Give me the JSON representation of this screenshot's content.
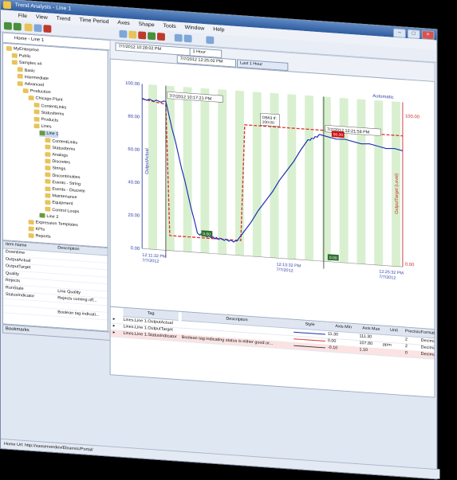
{
  "window": {
    "title": "Trend Analysis - Line 1"
  },
  "menu": [
    "File",
    "View",
    "Trend",
    "Time Period",
    "Axes",
    "Shape",
    "Tools",
    "Window",
    "Help"
  ],
  "breadcrumb": "Home - Line 1",
  "tree": [
    {
      "label": "MyEnterprise",
      "depth": 0,
      "icon": "folder"
    },
    {
      "label": "Public",
      "depth": 1,
      "icon": "folder"
    },
    {
      "label": "Samples v4",
      "depth": 1,
      "icon": "folder"
    },
    {
      "label": "Basic",
      "depth": 2,
      "icon": "folder"
    },
    {
      "label": "Intermediate",
      "depth": 2,
      "icon": "folder"
    },
    {
      "label": "Advanced",
      "depth": 2,
      "icon": "folder"
    },
    {
      "label": "Production",
      "depth": 3,
      "icon": "folder"
    },
    {
      "label": "Chicago Plant",
      "depth": 4,
      "icon": "folder"
    },
    {
      "label": "ContentLinks",
      "depth": 5,
      "icon": "folder"
    },
    {
      "label": "StatusItems",
      "depth": 5,
      "icon": "folder"
    },
    {
      "label": "Products",
      "depth": 5,
      "icon": "folder"
    },
    {
      "label": "Lines",
      "depth": 5,
      "icon": "folder"
    },
    {
      "label": "Line 1",
      "depth": 6,
      "icon": "green"
    },
    {
      "label": "ContentLinks",
      "depth": 7,
      "icon": "folder"
    },
    {
      "label": "StatusItems",
      "depth": 7,
      "icon": "folder"
    },
    {
      "label": "Analogs",
      "depth": 7,
      "icon": "folder"
    },
    {
      "label": "Discretes",
      "depth": 7,
      "icon": "folder"
    },
    {
      "label": "Strings",
      "depth": 7,
      "icon": "folder"
    },
    {
      "label": "Discontinuities",
      "depth": 7,
      "icon": "folder"
    },
    {
      "label": "Events - String",
      "depth": 7,
      "icon": "folder"
    },
    {
      "label": "Events - Discrete",
      "depth": 7,
      "icon": "folder"
    },
    {
      "label": "Maintenance",
      "depth": 7,
      "icon": "folder"
    },
    {
      "label": "Equipment",
      "depth": 7,
      "icon": "folder"
    },
    {
      "label": "Control Loops",
      "depth": 7,
      "icon": "folder"
    },
    {
      "label": "Line 2",
      "depth": 6,
      "icon": "green"
    },
    {
      "label": "Expression Templates",
      "depth": 4,
      "icon": "folder"
    },
    {
      "label": "KPIs",
      "depth": 4,
      "icon": "folder"
    },
    {
      "label": "Reports",
      "depth": 4,
      "icon": "folder"
    }
  ],
  "props": {
    "headers": [
      "Item Name",
      "Description"
    ],
    "rows": [
      {
        "name": "Downtime",
        "desc": ""
      },
      {
        "name": "OutputActual",
        "desc": ""
      },
      {
        "name": "OutputTarget",
        "desc": ""
      },
      {
        "name": "Quality",
        "desc": ""
      },
      {
        "name": "Rejects",
        "desc": ""
      },
      {
        "name": "RunState",
        "desc": "Line Quality"
      },
      {
        "name": "StatusIndicator",
        "desc": "Rejects coming off..."
      },
      {
        "name": "",
        "desc": ""
      },
      {
        "name": "",
        "desc": "Boolean tag indicati..."
      }
    ]
  },
  "bookmarks": "Bookmarks",
  "status": "Home Url:   http://vasserverdev/Ebservic/Portal/",
  "trendbar": {
    "start": "7/7/2012 10:28:02 PM",
    "end": "7/7/2012 12:25:02 PM",
    "span": "1 Hour",
    "period": "Last 1 Hour"
  },
  "chart": {
    "y_ticks": [
      "100.00",
      "80.00",
      "60.00",
      "40.00",
      "20.00",
      "0.00"
    ],
    "y_left_label": "OutputActual",
    "y_right_label": "OutputTarget (Level)",
    "right_max": "100.00",
    "right_min": "0.00",
    "corner": "Automatic",
    "x_left": "12:11:32 PM\n7/7/2012",
    "x_mid": "12:13:32 PM\n7/7/2012",
    "x_right": "12:25:32 PM\n7/7/2012",
    "cursor1": "7/7/2012 10:17:21 PM",
    "cursor2": "7/7/2012 12:21:58 PM",
    "cursor_mid": "0.00",
    "marker_a": "0.00",
    "marker_b": "90.00",
    "marker_c": "0.00",
    "note": "OB63 tf:\n100.00"
  },
  "grid": {
    "headers": [
      "Tag",
      "Description",
      "Style",
      "Axis Min",
      "Axis Max",
      "Unit",
      "Precision",
      "Format"
    ],
    "rows": [
      {
        "tag": "Lines.Line 1.OutputActual",
        "desc": "",
        "min": "11.30",
        "max": "111.30",
        "unit": "",
        "prec": "2",
        "fmt": "Decimal"
      },
      {
        "tag": "Lines.Line 1.OutputTarget",
        "desc": "",
        "min": "0.00",
        "max": "107.80",
        "unit": "ppm",
        "prec": "2",
        "fmt": "Decimal"
      },
      {
        "tag": "Lines.Line 1.StatusIndicator",
        "desc": "Boolean tag indicating status is either good or...",
        "min": "-0.10",
        "max": "1.10",
        "unit": "",
        "prec": "0",
        "fmt": "Decimal"
      }
    ]
  },
  "colors": {
    "actual": "#1a2fb5",
    "target": "#e0322b",
    "band": "#d9f0d0"
  }
}
